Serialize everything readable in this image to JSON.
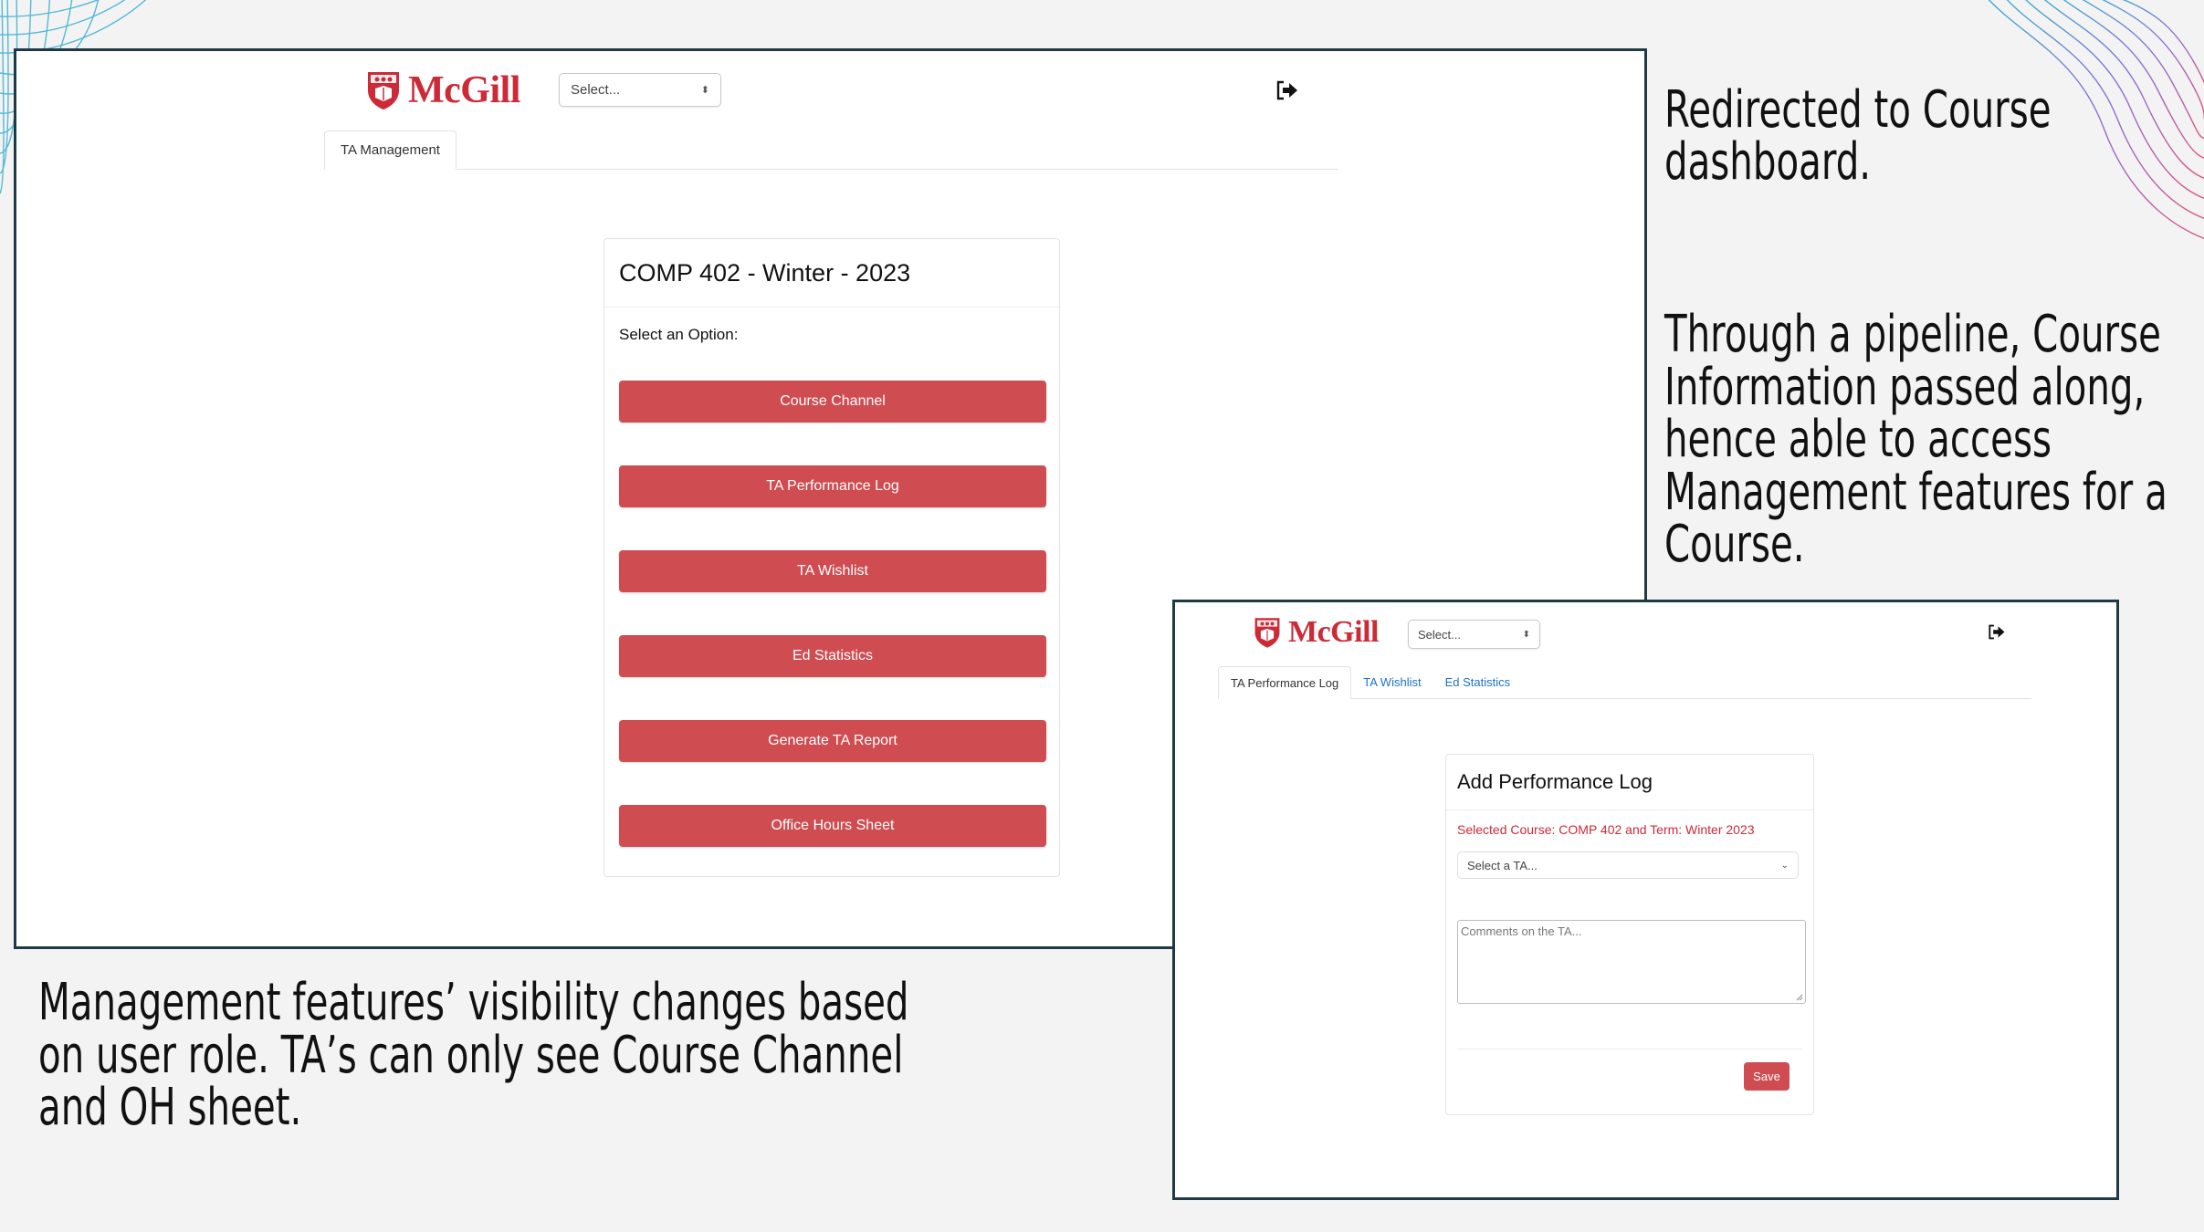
{
  "colors": {
    "accent_red": "#cf4c51",
    "mcgill_red": "#cd2a37",
    "frame_border": "#1f3a44",
    "link_blue": "#1a73c9"
  },
  "captions": {
    "top_right": [
      "Redirected to Course",
      "dashboard."
    ],
    "middle_right": [
      "Through a pipeline, Course",
      "Information passed along,",
      "hence able to access",
      "Management features for a",
      "Course."
    ],
    "bottom_left": [
      "Management features’ visibility changes based",
      "on user role. TA’s can only see Course Channel",
      "and OH sheet."
    ]
  },
  "screen1": {
    "logo_text": "McGill",
    "logo_icon": "mcgill-crest-icon",
    "select_label": "Select...",
    "logout_icon": "sign-out-icon",
    "tabs": [
      {
        "label": "TA Management",
        "active": true
      }
    ],
    "card_title": "COMP 402 - Winter - 2023",
    "prompt": "Select an Option:",
    "buttons": [
      "Course Channel",
      "TA Performance Log",
      "TA Wishlist",
      "Ed Statistics",
      "Generate TA Report",
      "Office Hours Sheet"
    ]
  },
  "screen2": {
    "logo_text": "McGill",
    "logo_icon": "mcgill-crest-icon",
    "select_label": "Select...",
    "logout_icon": "sign-out-icon",
    "tabs": [
      {
        "label": "TA Performance Log",
        "active": true
      },
      {
        "label": "TA Wishlist",
        "active": false
      },
      {
        "label": "Ed Statistics",
        "active": false
      }
    ],
    "card_title": "Add Performance Log",
    "selected_course": "Selected Course: COMP 402 and Term: Winter 2023",
    "ta_select_placeholder": "Select a TA...",
    "comments_placeholder": "Comments on the TA...",
    "save_label": "Save"
  }
}
